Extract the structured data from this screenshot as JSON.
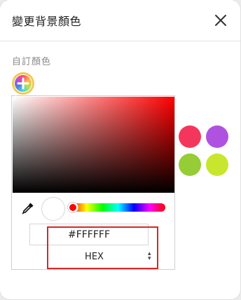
{
  "header": {
    "title": "變更背景顏色"
  },
  "custom_section": {
    "label": "自訂顏色"
  },
  "picker": {
    "hex_value": "#FFFFFF",
    "format_label": "HEX",
    "selected_color": "#FFFFFF",
    "hue_color": "#FF0000",
    "hue_value_fraction": 0
  },
  "preset_swatches": [
    {
      "color": "#F5365C"
    },
    {
      "color": "#B052E0"
    },
    {
      "color": "#96CC35"
    },
    {
      "color": "#C8E62E"
    }
  ],
  "colors": {
    "highlight": "#D62828",
    "add_button_ring": "#F2C94C"
  },
  "icons": {
    "close": "close-icon",
    "add": "plus-icon",
    "eyedropper": "eyedropper-icon",
    "select_arrows": "updown-arrows-icon"
  }
}
